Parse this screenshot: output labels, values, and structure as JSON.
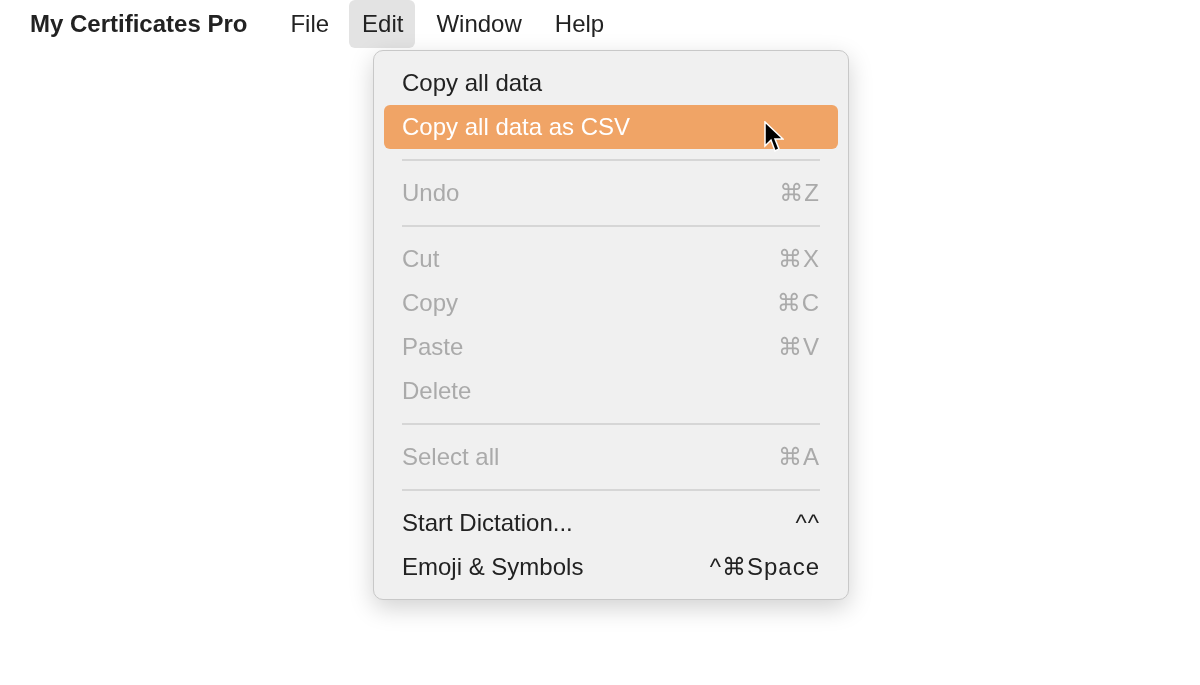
{
  "menubar": {
    "app_name": "My Certificates Pro",
    "menus": [
      {
        "label": "File",
        "selected": false
      },
      {
        "label": "Edit",
        "selected": true
      },
      {
        "label": "Window",
        "selected": false
      },
      {
        "label": "Help",
        "selected": false
      }
    ]
  },
  "dropdown": {
    "items": [
      {
        "kind": "item",
        "label": "Copy all data",
        "disabled": false,
        "selected": false
      },
      {
        "kind": "item",
        "label": "Copy all data as CSV",
        "disabled": false,
        "selected": true
      },
      {
        "kind": "separator"
      },
      {
        "kind": "item",
        "label": "Undo",
        "shortcut": "⌘Z",
        "disabled": true,
        "selected": false
      },
      {
        "kind": "separator"
      },
      {
        "kind": "item",
        "label": "Cut",
        "shortcut": "⌘X",
        "disabled": true,
        "selected": false
      },
      {
        "kind": "item",
        "label": "Copy",
        "shortcut": "⌘C",
        "disabled": true,
        "selected": false
      },
      {
        "kind": "item",
        "label": "Paste",
        "shortcut": "⌘V",
        "disabled": true,
        "selected": false
      },
      {
        "kind": "item",
        "label": "Delete",
        "disabled": true,
        "selected": false
      },
      {
        "kind": "separator"
      },
      {
        "kind": "item",
        "label": "Select all",
        "shortcut": "⌘A",
        "disabled": true,
        "selected": false
      },
      {
        "kind": "separator"
      },
      {
        "kind": "item",
        "label": "Start Dictation...",
        "shortcut": "^^",
        "disabled": false,
        "selected": false
      },
      {
        "kind": "item",
        "label": "Emoji & Symbols",
        "shortcut": "^⌘Space",
        "disabled": false,
        "selected": false
      }
    ]
  }
}
